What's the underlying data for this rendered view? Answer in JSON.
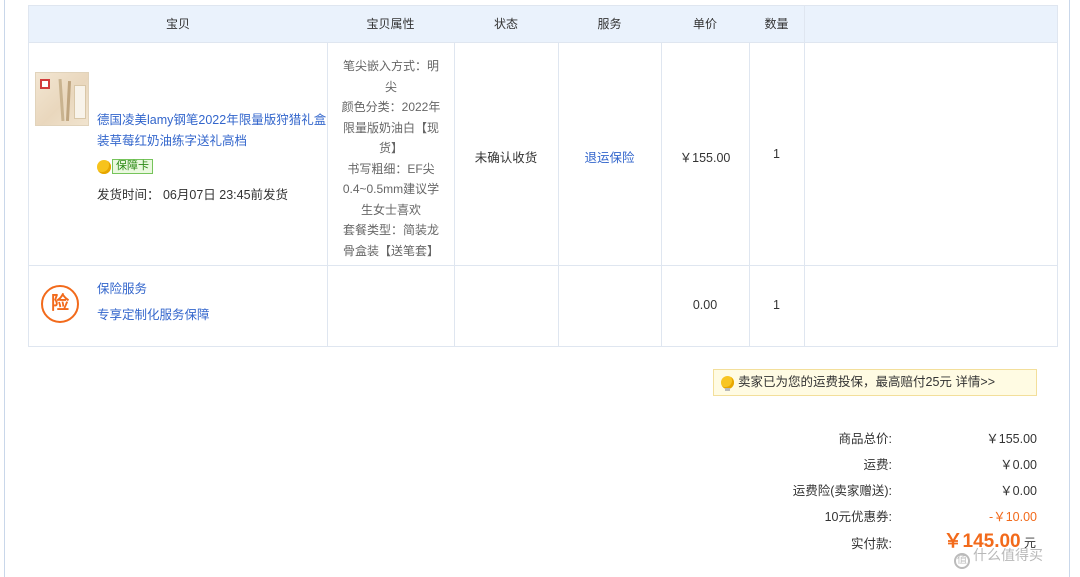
{
  "table": {
    "headers": {
      "item": "宝贝",
      "attributes": "宝贝属性",
      "status": "状态",
      "service": "服务",
      "unit_price": "单价",
      "quantity": "数量"
    },
    "product": {
      "title": "德国凌美lamy钢笔2022年限量版狩猎礼盒装草莓红奶油练字送礼高档",
      "badge": "保障卡",
      "ship_time": "发货时间：  06月07日 23:45前发货",
      "attributes": "笔尖嵌入方式：明尖\n颜色分类：2022年限量版奶油白【现货】\n书写粗细：EF尖0.4~0.5mm建议学生女士喜欢\n套餐类型：简装龙骨盒装【送笔套】",
      "status": "未确认收货",
      "service": "退运保险",
      "unit_price": "￥155.00",
      "quantity": "1"
    },
    "insurance": {
      "icon_char": "险",
      "title": "保险服务",
      "subtitle": "专享定制化服务保障",
      "unit_price": "0.00",
      "quantity": "1"
    }
  },
  "notice": {
    "text": "卖家已为您的运费投保，最高赔付25元",
    "details_link": "详情>>"
  },
  "summary": [
    {
      "label": "商品总价:",
      "value": "￥155.00",
      "highlight": false
    },
    {
      "label": "运费:",
      "value": "￥0.00",
      "highlight": false
    },
    {
      "label": "运费险(卖家赠送):",
      "value": "￥0.00",
      "highlight": false
    },
    {
      "label": "10元优惠券:",
      "value": "-￥10.00",
      "highlight": true
    },
    {
      "label": "实付款:",
      "value": "",
      "highlight": false
    }
  ],
  "total": {
    "amount": "￥145.00",
    "unit": "元"
  },
  "watermark": {
    "icon_char": "值",
    "text": "什么值得买"
  },
  "colors": {
    "link": "#3366cc",
    "accent": "#f26a1b",
    "header_bg": "#eaf2fc",
    "border": "#dfe6f0",
    "notice_bg": "#fffbe3"
  }
}
